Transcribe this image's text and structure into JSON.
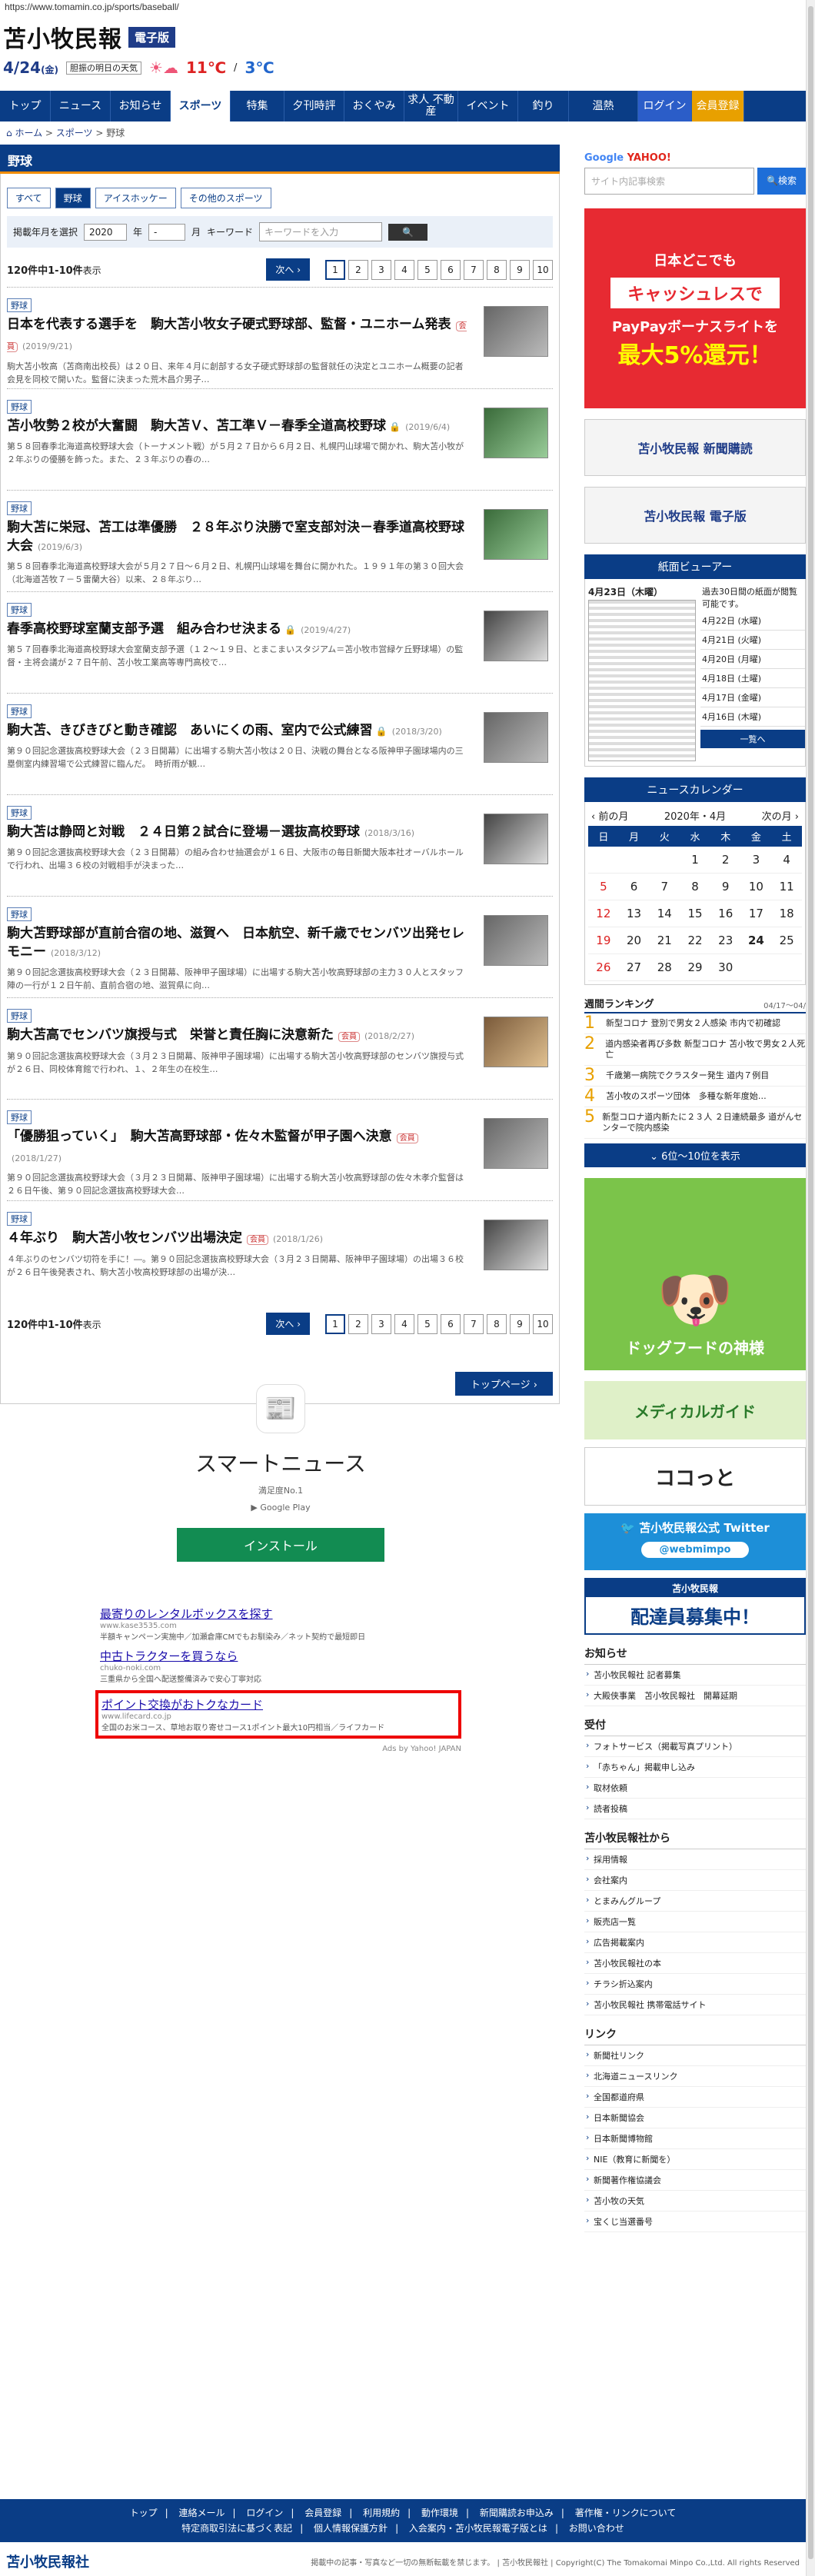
{
  "browser": {
    "url": "https://www.tomamin.co.jp/sports/baseball/"
  },
  "header": {
    "logo": "苫小牧民報",
    "edition": "電子版",
    "date": "4/24",
    "weekday": "(金)",
    "weather_label": "胆振の明日の天気",
    "temp_high": "11℃",
    "temp_low": "3℃"
  },
  "nav": [
    "トップ",
    "ニュース",
    "お知らせ",
    "スポーツ",
    "特集",
    "夕刊時評",
    "おくやみ",
    "求人 不動産",
    "イベント",
    "釣り",
    "温熱"
  ],
  "nav_login": "ログイン",
  "nav_member": "会員登録",
  "breadcrumb": {
    "home": "ホーム",
    "sports": "スポーツ",
    "current": "野球"
  },
  "section_title": "野球",
  "subtabs": [
    "すべて",
    "野球",
    "アイスホッケー",
    "その他のスポーツ"
  ],
  "search": {
    "label": "掲載年月を選択",
    "year": "2020",
    "year_unit": "年",
    "month": "-",
    "month_unit": "月",
    "keyword_label": "キーワード",
    "keyword_placeholder": "キーワードを入力"
  },
  "results": {
    "count": "120件中1-10件",
    "shown": "表示",
    "next": "次へ",
    "pages": [
      "1",
      "2",
      "3",
      "4",
      "5",
      "6",
      "7",
      "8",
      "9",
      "10"
    ]
  },
  "articles": [
    {
      "tag": "野球",
      "title": "日本を代表する選手を　駒大苫小牧女子硬式野球部、監督・ユニホーム発表",
      "badge": "",
      "date": "(2019/9/21)",
      "desc": "駒大苫小牧高（苫商南出校長）は２０日、来年４月に創部する女子硬式野球部の監督就任の決定とユニホーム概要の記者会見を同校で開いた。監督に決まった荒木昌介男子…"
    },
    {
      "tag": "野球",
      "title": "苫小牧勢２校が大奮闘　駒大苫Ｖ、苫工準Ｖ－春季全道高校野球",
      "badge": "",
      "date": "(2019/6/4)",
      "desc": "第５８回春季北海道高校野球大会（トーナメント戦）が５月２７日から６月２日、札幌円山球場で開かれ、駒大苫小牧が２年ぶりの優勝を飾った。また、２３年ぶりの春の…"
    },
    {
      "tag": "野球",
      "title": "駒大苫に栄冠、苫工は準優勝　２８年ぶり決勝で室支部対決－春季道高校野球大会",
      "badge": "",
      "date": "(2019/6/3)",
      "desc": "第５８回春季北海道高校野球大会が５月２７日～６月２日、札幌円山球場を舞台に開かれた。１９９１年の第３０回大会（北海道苫牧７－５雷蘭大谷）以来、２８年ぶり…"
    },
    {
      "tag": "野球",
      "title": "春季高校野球室蘭支部予選　組み合わせ決まる",
      "badge": "",
      "date": "(2019/4/27)",
      "desc": "第５７回春季北海道高校野球大会室蘭支部予選（１２～１９日、とまこまいスタジアム＝苫小牧市営緑ケ丘野球場）の監督・主将会議が２７日午前、苫小牧工業高等専門高校で…"
    },
    {
      "tag": "野球",
      "title": "駒大苫、きびきびと動き確認　あいにくの雨、室内で公式練習",
      "badge": "",
      "date": "(2018/3/20)",
      "desc": "第９０回記念選抜高校野球大会（２３日開幕）に出場する駒大苫小牧は２０日、決戦の舞台となる阪神甲子園球場内の三塁側室内練習場で公式練習に臨んだ。　時折雨が観…"
    },
    {
      "tag": "野球",
      "title": "駒大苫は静岡と対戦　２４日第２試合に登場－選抜高校野球",
      "badge": "",
      "date": "(2018/3/16)",
      "desc": "第９０回記念選抜高校野球大会（２３日開幕）の組み合わせ抽選会が１６日、大阪市の毎日新聞大阪本社オーバルホールで行われ、出場３６校の対戦相手が決まった…"
    },
    {
      "tag": "野球",
      "title": "駒大苫野球部が直前合宿の地、滋賀へ　日本航空、新千歳でセンバツ出発セレモニー",
      "badge": "",
      "date": "(2018/3/12)",
      "desc": "第９０回記念選抜高校野球大会（２３日開幕、阪神甲子園球場）に出場する駒大苫小牧高野球部の主力３０人とスタッフ陣の一行が１２日午前、直前合宿の地、滋賀県に向…"
    },
    {
      "tag": "野球",
      "title": "駒大苫高でセンバツ旗授与式　栄誉と責任胸に決意新た",
      "badge": "",
      "date": "(2018/2/27)",
      "desc": "第９０回記念選抜高校野球大会（３月２３日開幕、阪神甲子園球場）に出場する駒大苫小牧高野球部のセンバツ旗授与式が２６日、同校体育館で行われ、１、２年生の在校生…"
    },
    {
      "tag": "野球",
      "title": "「優勝狙っていく」　駒大苫高野球部・佐々木監督が甲子園へ決意",
      "badge": "",
      "date": "(2018/1/27)",
      "desc": "第９０回記念選抜高校野球大会（３月２３日開幕、阪神甲子園球場）に出場する駒大苫小牧高野球部の佐々木孝介監督は２６日午後、第９０回記念選抜高校野球大会…"
    },
    {
      "tag": "野球",
      "title": "４年ぶり　駒大苫小牧センバツ出場決定",
      "badge": "",
      "date": "(2018/1/26)",
      "desc": "４年ぶりのセンバツ切符を手に！―。第９０回記念選抜高校野球大会（３月２３日開幕、阪神甲子園球場）の出場３６校が２６日午後発表され、駒大苫小牧高校野球部の出場が決…"
    }
  ],
  "article_badge": "会員",
  "top_page": "トップページ",
  "smartnews": {
    "title": "スマートニュース",
    "sub": "満足度No.1",
    "store": "Google Play",
    "install": "インストール"
  },
  "ads": [
    {
      "title": "最寄りのレンタルボックスを探す",
      "url": "www.kase3535.com",
      "desc": "半額キャンペーン実施中／加瀬倉庫CMでもお馴染み／ネット契約で最短即日"
    },
    {
      "title": "中古トラクターを買うなら",
      "url": "chuko-noki.com",
      "desc": "三重県から全国へ配送整備済みで安心丁寧対応"
    },
    {
      "title": "ポイント交換がおトクなカード",
      "url": "www.lifecard.co.jp",
      "desc": "全国のお米コース、草地お取り寄せコース1ポイント最大10円相当／ライフカード"
    }
  ],
  "ads_by": "Ads by Yahoo! JAPAN",
  "sidebar": {
    "search_logo_g": "Google",
    "search_logo_y": "YAHOO!",
    "search_placeholder": "サイト内記事検索",
    "search_btn": "検索",
    "ad": {
      "l1": "日本どこでも",
      "l2": "キャッシュレスで",
      "l3": "PayPayボーナスライトを",
      "l4": "最大5%還元！"
    },
    "promo1": "苫小牧民報 新聞購読",
    "promo2": "苫小牧民報 電子版",
    "viewer_title": "紙面ビューアー",
    "viewer_date": "4月23日（木曜）",
    "viewer_note": "過去30日間の紙面が閲覧可能です。",
    "viewer_dates": [
      "4月22日 (水曜)",
      "4月21日 (火曜)",
      "4月20日 (月曜)",
      "4月18日 (土曜)",
      "4月17日 (金曜)",
      "4月16日 (木曜)"
    ],
    "viewer_list": "一覧へ",
    "cal_title": "ニュースカレンダー",
    "cal_prev": "前の月",
    "cal_month": "2020年・4月",
    "cal_next": "次の月",
    "cal_heads": [
      "日",
      "月",
      "火",
      "水",
      "木",
      "金",
      "土"
    ],
    "cal_days": [
      "",
      "",
      "",
      "1",
      "2",
      "3",
      "4",
      "5",
      "6",
      "7",
      "8",
      "9",
      "10",
      "11",
      "12",
      "13",
      "14",
      "15",
      "16",
      "17",
      "18",
      "19",
      "20",
      "21",
      "22",
      "23",
      "24",
      "25",
      "26",
      "27",
      "28",
      "29",
      "30",
      "",
      ""
    ],
    "rank_title": "週間ランキング",
    "rank_period": "04/17～04/",
    "ranks": [
      "新型コロナ 登別で男女２人感染 市内で初確認",
      "道内感染者再び多数 新型コロナ 苫小牧で男女２人死亡",
      "千歳第一病院でクラスター発生 道内７例目",
      "苫小牧のスポーツ団体　多種な新年度始…",
      "新型コロナ道内新たに２３人 ２日連続最多 道がんセンターで院内感染"
    ],
    "rank_more": "6位〜10位を表示",
    "img1": "ドッグフードの神様",
    "img2": "メディカルガイド",
    "img3": "ココっと",
    "twitter": "苫小牧民報公式 Twitter",
    "twitter_handle": "@webmimpo",
    "recruit_a": "苫小牧民報",
    "recruit_b": "配達員募集中！",
    "oshirase_h": "お知らせ",
    "oshirase": [
      "苫小牧民報社 記者募集",
      "大殿侠事業　苫小牧民報社　開幕延期"
    ],
    "uketsuke_h": "受付",
    "uketsuke": [
      "フォトサービス（掲載写真プリント）",
      "「赤ちゃん」掲載申し込み",
      "取材依頼",
      "読者投稿"
    ],
    "company_h": "苫小牧民報社から",
    "company": [
      "採用情報",
      "会社案内",
      "とまみんグループ",
      "販売店一覧",
      "広告掲載案内",
      "苫小牧民報社の本",
      "チラシ折込案内",
      "苫小牧民報社 携帯電話サイト"
    ],
    "link_h": "リンク",
    "links": [
      "新聞社リンク",
      "北海道ニュースリンク",
      "全国都道府県",
      "日本新聞協会",
      "日本新聞博物館",
      "NIE（教育に新聞を）",
      "新聞著作権協議会",
      "苫小牧の天気",
      "宝くじ当選番号"
    ]
  },
  "footer": {
    "row1": [
      "トップ",
      "連絡メール",
      "ログイン",
      "会員登録",
      "利用規約",
      "動作環境",
      "新聞購読お申込み",
      "著作権・リンクについて"
    ],
    "row2": [
      "特定商取引法に基づく表記",
      "個人情報保護方針",
      "入会案内・苫小牧民報電子版とは",
      "お問い合わせ"
    ]
  },
  "footer_logo": "苫小牧民報社",
  "copyright": "掲載中の記事・写真など一切の無断転載を禁じます。 | 苫小牧民報社 | Copyright(C) The Tomakomai Minpo Co.,Ltd. All rights Reserved"
}
